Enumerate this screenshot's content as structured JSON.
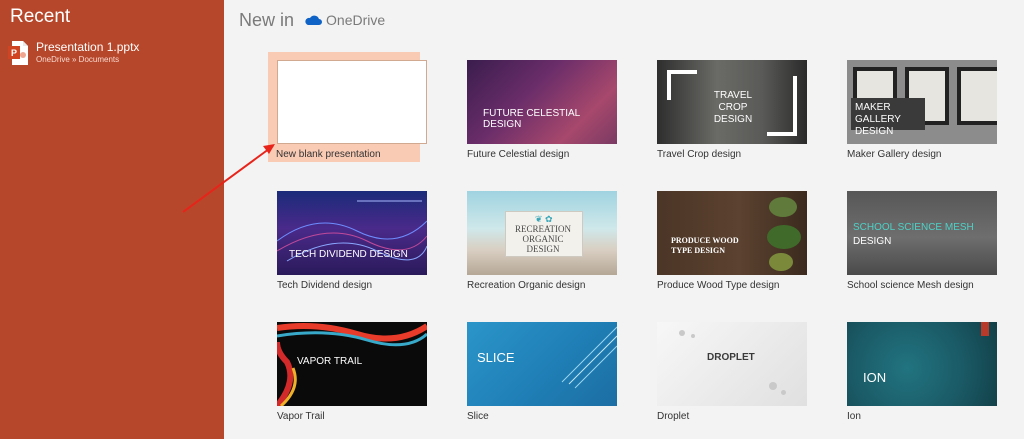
{
  "sidebar": {
    "title": "Recent",
    "recent_files": [
      {
        "name": "Presentation 1.pptx",
        "path": "OneDrive » Documents"
      }
    ]
  },
  "header": {
    "title": "New in",
    "service": "OneDrive"
  },
  "templates": [
    {
      "label": "New blank presentation",
      "thumb_text": ""
    },
    {
      "label": "Future Celestial design",
      "thumb_text": "FUTURE CELESTIAL DESIGN"
    },
    {
      "label": "Travel Crop design",
      "thumb_text": "TRAVEL CROP DESIGN"
    },
    {
      "label": "Maker Gallery design",
      "thumb_text": "MAKER GALLERY DESIGN"
    },
    {
      "label": "Tech Dividend design",
      "thumb_text": "TECH DIVIDEND DESIGN"
    },
    {
      "label": "Recreation Organic design",
      "thumb_text": "RECREATION ORGANIC DESIGN"
    },
    {
      "label": "Produce Wood Type design",
      "thumb_text": "PRODUCE WOOD TYPE DESIGN"
    },
    {
      "label": "School science Mesh design",
      "thumb_text": "SCHOOL SCIENCE MESH",
      "thumb_subtext": "DESIGN"
    },
    {
      "label": "Vapor Trail",
      "thumb_text": "VAPOR TRAIL"
    },
    {
      "label": "Slice",
      "thumb_text": "SLICE"
    },
    {
      "label": "Droplet",
      "thumb_text": "DROPLET"
    },
    {
      "label": "Ion",
      "thumb_text": "ION"
    }
  ],
  "colors": {
    "sidebar_bg": "#b7472a",
    "selected_tile": "#f9cab4",
    "annotation_arrow": "#e8231a"
  }
}
